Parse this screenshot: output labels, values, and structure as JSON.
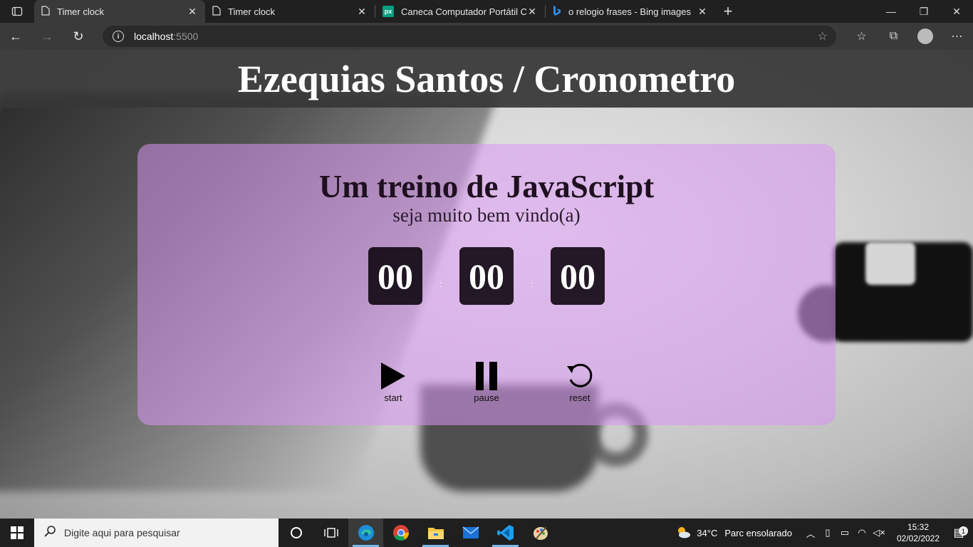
{
  "browser": {
    "tabs": [
      {
        "title": "Timer clock",
        "icon": "page-icon",
        "active": true
      },
      {
        "title": "Timer clock",
        "icon": "page-icon",
        "active": false
      },
      {
        "title": "Caneca Computador Portátil Câm",
        "icon": "pexels-icon",
        "active": false
      },
      {
        "title": "o relogio frases - Bing images",
        "icon": "bing-icon",
        "active": false
      }
    ],
    "address": {
      "host": "localhost",
      "port": ":5500"
    }
  },
  "page": {
    "header_title": "Ezequias Santos / Cronometro",
    "card": {
      "title": "Um treino de JavaScript",
      "subtitle": "seja muito bem vindo(a)",
      "timer": {
        "hours": "00",
        "minutes": "00",
        "seconds": "00",
        "separator": ":"
      },
      "controls": {
        "start": "start",
        "pause": "pause",
        "reset": "reset"
      }
    }
  },
  "taskbar": {
    "search_placeholder": "Digite aqui para pesquisar",
    "weather": {
      "temp": "34°C",
      "desc": "Parc ensolarado"
    },
    "clock": {
      "time": "15:32",
      "date": "02/02/2022"
    },
    "notifications": "1"
  },
  "colors": {
    "card_bg": "#d896f0",
    "header_bg": "#373737",
    "digit_bg": "#120a14"
  }
}
